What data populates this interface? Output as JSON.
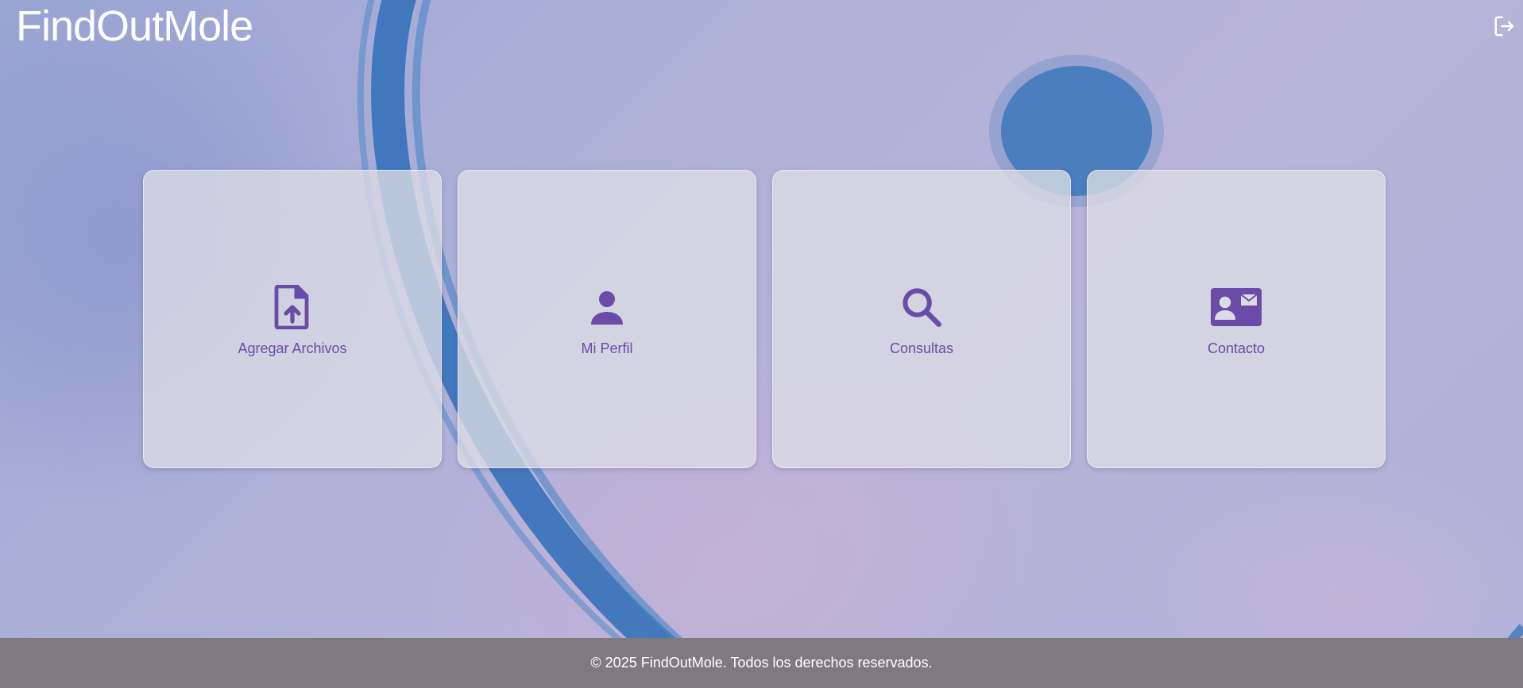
{
  "header": {
    "title": "FindOutMole",
    "logout_icon": "logout-icon"
  },
  "cards": [
    {
      "label": "Agregar Archivos",
      "icon": "file-upload-icon"
    },
    {
      "label": "Mi Perfil",
      "icon": "person-icon"
    },
    {
      "label": "Consultas",
      "icon": "search-icon"
    },
    {
      "label": "Contacto",
      "icon": "contact-card-icon"
    }
  ],
  "footer": {
    "text": "© 2025 FindOutMole. Todos los derechos reservados."
  },
  "colors": {
    "accent": "#6a4ca8",
    "footer_bg": "#7e7a80",
    "card_bg": "#dcdce4"
  }
}
